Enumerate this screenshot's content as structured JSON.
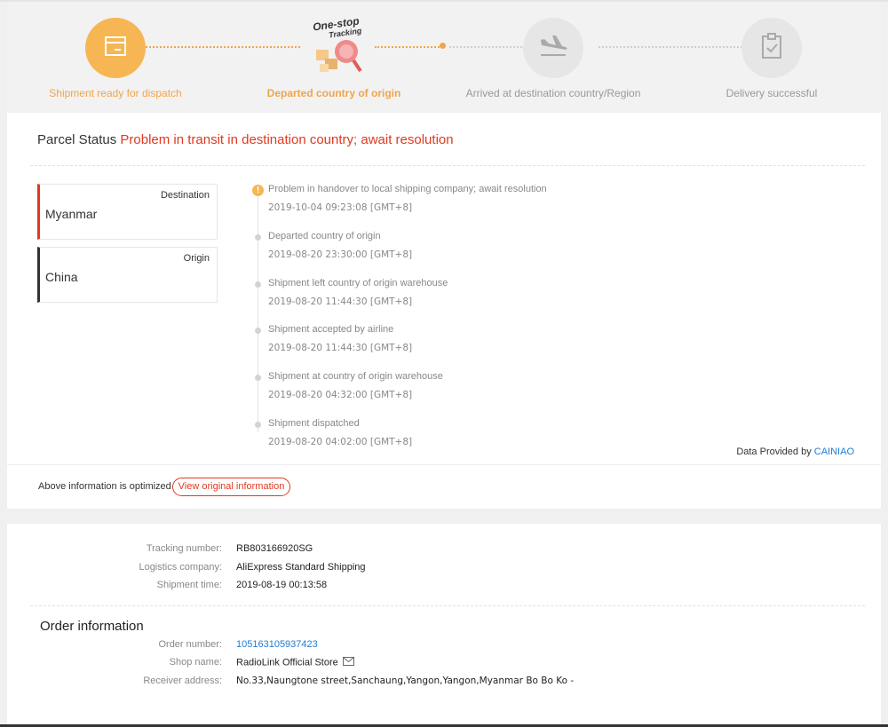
{
  "progress": {
    "steps": [
      {
        "label": "Shipment ready for dispatch",
        "icon": "package-icon",
        "state": "done"
      },
      {
        "label": "Departed country of origin",
        "icon": "one-stop-tracking-icon",
        "state": "current"
      },
      {
        "label": "Arrived at destination country/Region",
        "icon": "airplane-landing-icon",
        "state": "todo"
      },
      {
        "label": "Delivery successful",
        "icon": "clipboard-check-icon",
        "state": "todo"
      }
    ],
    "badge_line1": "One-stop",
    "badge_line2": "Tracking",
    "colors": {
      "done": "#f6b653",
      "todo": "#e6e6e6",
      "done_text": "#f0a54a",
      "todo_text": "#999999"
    }
  },
  "parcel": {
    "status_label": "Parcel Status",
    "status_value": "Problem in transit in destination country; await resolution",
    "destination": {
      "tag": "Destination",
      "country": "Myanmar"
    },
    "origin": {
      "tag": "Origin",
      "country": "China"
    },
    "events": [
      {
        "title": "Problem in handover to local shipping company; await resolution",
        "time": "2019-10-04 09:23:08 [GMT+8]",
        "warn": true
      },
      {
        "title": "Departed country of origin",
        "time": "2019-08-20 23:30:00 [GMT+8]"
      },
      {
        "title": "Shipment left country of origin warehouse",
        "time": "2019-08-20 11:44:30 [GMT+8]"
      },
      {
        "title": "Shipment accepted by airline",
        "time": "2019-08-20 11:44:30 [GMT+8]"
      },
      {
        "title": "Shipment at country of origin warehouse",
        "time": "2019-08-20 04:32:00 [GMT+8]"
      },
      {
        "title": "Shipment dispatched",
        "time": "2019-08-20 04:02:00 [GMT+8]"
      }
    ],
    "provided_prefix": "Data Provided by",
    "provided_link": "CAINIAO",
    "optimized_text": "Above information is optimized",
    "view_button": "View original information"
  },
  "shipping": {
    "tracking_label": "Tracking number:",
    "tracking_value": "RB803166920SG",
    "logistics_label": "Logistics company:",
    "logistics_value": "AliExpress Standard Shipping",
    "shipment_time_label": "Shipment time:",
    "shipment_time_value": "2019-08-19 00:13:58"
  },
  "order": {
    "title": "Order information",
    "order_number_label": "Order number:",
    "order_number_value": "105163105937423",
    "shop_label": "Shop name:",
    "shop_value": "RadioLink Official Store",
    "receiver_label": "Receiver address:",
    "receiver_value": "No.33,Naungtone street,Sanchaung,Yangon,Yangon,Myanmar Bo Bo Ko -"
  },
  "colors": {
    "accent_red": "#e0391f",
    "link_blue": "#1f7bd6",
    "accent_orange": "#f0a54a"
  }
}
